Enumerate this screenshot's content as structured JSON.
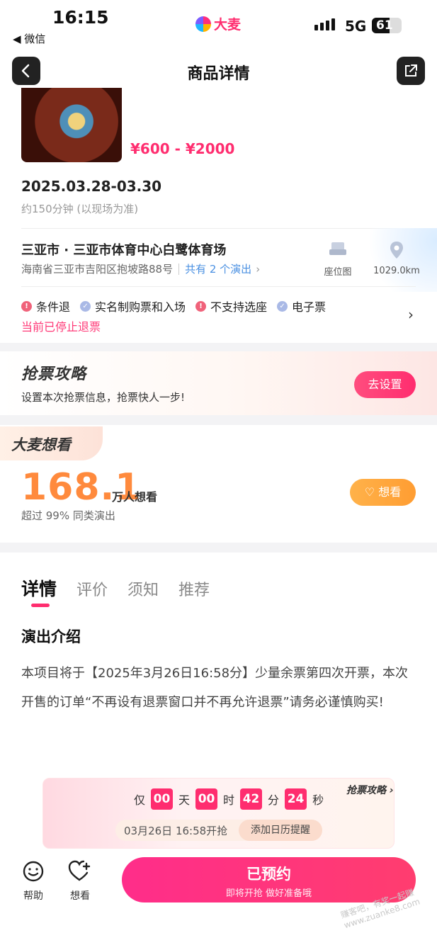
{
  "status_bar": {
    "time": "16:15",
    "back_app": "◀ 微信",
    "brand": "大麦",
    "network": "5G",
    "battery": "61"
  },
  "nav": {
    "title": "商品详情"
  },
  "show": {
    "price": "¥600 - ¥2000",
    "date": "2025.03.28-03.30",
    "duration": "约150分钟 (以现场为准)"
  },
  "venue": {
    "name": "三亚市 · 三亚市体育中心白鹭体育场",
    "address": "海南省三亚市吉阳区抱坡路88号",
    "shows": "共有 2 个演出",
    "seatmap_label": "座位图",
    "distance": "1029.0km"
  },
  "policies": [
    {
      "label": "条件退",
      "type": "warn"
    },
    {
      "label": "实名制购票和入场",
      "type": "ok"
    },
    {
      "label": "不支持选座",
      "type": "warn"
    },
    {
      "label": "电子票",
      "type": "ok"
    }
  ],
  "refund_notice": "当前已停止退票",
  "strategy": {
    "title": "抢票攻略",
    "subtitle": "设置本次抢票信息，抢票快人一步!",
    "button": "去设置"
  },
  "want": {
    "tag": "大麦想看",
    "count": "168.1",
    "unit": "万人想看",
    "percent": "超过 99% 同类演出",
    "button": "想看"
  },
  "tabs": [
    "详情",
    "评价",
    "须知",
    "推荐"
  ],
  "intro": {
    "heading": "演出介绍",
    "text": "本项目将于【2025年3月26日16:58分】少量余票第四次开票，本次开售的订单“不再设有退票窗口并不再允许退票”请务必谨慎购买!"
  },
  "countdown": {
    "prefix": "仅",
    "days": "00",
    "days_unit": "天",
    "hours": "00",
    "hours_unit": "时",
    "minutes": "42",
    "minutes_unit": "分",
    "seconds": "24",
    "seconds_unit": "秒",
    "strategy_link": "抢票攻略",
    "open_time": "03月26日 16:58开抢",
    "calendar_button": "添加日历提醒"
  },
  "bottom_bar": {
    "help": "帮助",
    "want": "想看",
    "reserve_main": "已预约",
    "reserve_sub": "即将开抢 做好准备哦"
  },
  "watermark": "赚客吧，有奖一起赚 www.zuanke8.com",
  "colors": {
    "accent": "#ff2d6f",
    "orange": "#ff8a3d",
    "link": "#4a90e2"
  }
}
